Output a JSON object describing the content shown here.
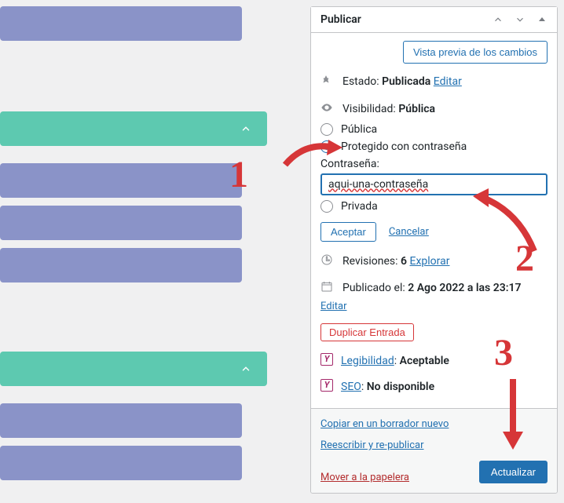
{
  "panel": {
    "title": "Publicar",
    "preview_btn": "Vista previa de los cambios",
    "status": {
      "label": "Estado:",
      "value": "Publicada",
      "edit": "Editar"
    },
    "visibility": {
      "label": "Visibilidad:",
      "value": "Pública",
      "options": {
        "public": "Pública",
        "password": "Protegido con contraseña",
        "private": "Privada"
      },
      "pw_label": "Contraseña:",
      "pw_value": "aqui-una-contraseña",
      "accept": "Aceptar",
      "cancel": "Cancelar"
    },
    "revisions": {
      "label": "Revisiones:",
      "count": "6",
      "explore": "Explorar"
    },
    "published": {
      "label": "Publicado el:",
      "value": "2 Ago 2022 a las 23:17",
      "edit": "Editar"
    },
    "duplicate": "Duplicar Entrada",
    "yoast": {
      "readability_label": "Legibilidad",
      "readability_value": "Aceptable",
      "seo_label": "SEO",
      "seo_value": "No disponible"
    }
  },
  "foot": {
    "copy_draft": "Copiar en un borrador nuevo",
    "rewrite": "Reescribir y re-publicar",
    "trash": "Mover a la papelera",
    "update": "Actualizar"
  },
  "annotations": {
    "n1": "1",
    "n2": "2",
    "n3": "3"
  }
}
